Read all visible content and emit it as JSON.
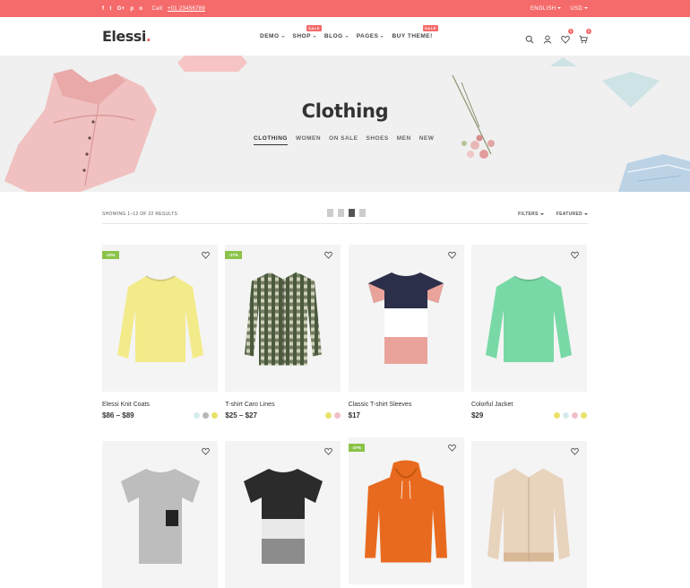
{
  "topbar": {
    "social": [
      "f",
      "t",
      "G+",
      "p",
      "o"
    ],
    "call_label": "Call:",
    "phone": "+01 23456789",
    "language": "ENGLISH",
    "currency": "USD"
  },
  "header": {
    "logo": "Elessi",
    "logo_dot": ".",
    "nav": [
      {
        "label": "DEMO",
        "badge": ""
      },
      {
        "label": "SHOP",
        "badge": "SALE"
      },
      {
        "label": "BLOG",
        "badge": ""
      },
      {
        "label": "PAGES",
        "badge": ""
      },
      {
        "label": "BUY THEME!",
        "badge": "SALE"
      }
    ],
    "wishlist_count": "0",
    "cart_count": "0"
  },
  "hero": {
    "title": "Clothing",
    "tabs": [
      "CLOTHING",
      "WOMEN",
      "ON SALE",
      "SHOES",
      "MEN",
      "NEW"
    ]
  },
  "toolbar": {
    "results": "SHOWING 1–12 OF 22 RESULTS",
    "filters": "FILTERS",
    "sort": "FEATURED"
  },
  "products": [
    {
      "name": "Elessi Knit Coats",
      "price": "$86 – $89",
      "discount": "-10%",
      "swatches": [
        "#d6ecec",
        "#b8b8b8",
        "#e8e26a"
      ],
      "garment": "sweater",
      "color": "#f3ea8a"
    },
    {
      "name": "T-shirt Caro Lines",
      "price": "$25 – $27",
      "discount": "-17%",
      "swatches": [
        "#e8e26a",
        "#f2bfc8"
      ],
      "garment": "shirt",
      "color": "#4b5a3e"
    },
    {
      "name": "Classic T-shirt Sleeves",
      "price": "$17",
      "discount": "",
      "swatches": [],
      "garment": "tee-block",
      "color": "#e9a39a"
    },
    {
      "name": "Colorful Jacket",
      "price": "$29",
      "discount": "",
      "swatches": [
        "#e8e26a",
        "#d6ecec",
        "#f2bfc8",
        "#e8e26a"
      ],
      "garment": "sweater",
      "color": "#79d9a6"
    },
    {
      "name": "",
      "price": "",
      "discount": "",
      "swatches": [],
      "garment": "tee-pocket",
      "color": "#bdbdbd"
    },
    {
      "name": "",
      "price": "",
      "discount": "",
      "swatches": [],
      "garment": "tee-block2",
      "color": "#2b2b2b"
    },
    {
      "name": "",
      "price": "",
      "discount": "-37%",
      "swatches": [],
      "garment": "hoodie",
      "color": "#e86a1f"
    },
    {
      "name": "",
      "price": "",
      "discount": "",
      "swatches": [],
      "garment": "jacket",
      "color": "#e8d3bd"
    }
  ],
  "colors": {
    "accent": "#f56b6b",
    "discount": "#8bc34a"
  }
}
